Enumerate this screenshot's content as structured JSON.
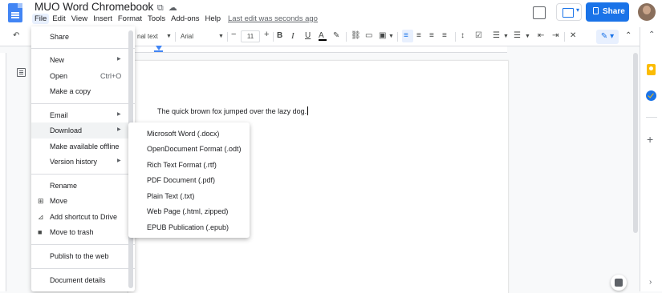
{
  "app": {
    "title": "MUO Word Chromebook",
    "last_edit": "Last edit was seconds ago",
    "share_label": "Share"
  },
  "menubar": [
    "File",
    "Edit",
    "View",
    "Insert",
    "Format",
    "Tools",
    "Add-ons",
    "Help"
  ],
  "toolbar": {
    "style": "nal text",
    "font": "Arial",
    "font_size": "11",
    "minus": "−",
    "plus": "+",
    "bold": "B",
    "italic": "I",
    "underline": "U",
    "text_color": "A"
  },
  "document": {
    "text": "The quick brown fox jumped over the lazy dog."
  },
  "file_menu": {
    "items": [
      {
        "label": "Share",
        "icon": "",
        "shortcut": "",
        "submenu": false
      },
      {
        "label": "New",
        "icon": "",
        "shortcut": "",
        "submenu": true
      },
      {
        "label": "Open",
        "icon": "",
        "shortcut": "Ctrl+O",
        "submenu": false
      },
      {
        "label": "Make a copy",
        "icon": "",
        "shortcut": "",
        "submenu": false
      },
      {
        "label": "Email",
        "icon": "",
        "shortcut": "",
        "submenu": true
      },
      {
        "label": "Download",
        "icon": "",
        "shortcut": "",
        "submenu": true
      },
      {
        "label": "Make available offline",
        "icon": "",
        "shortcut": "",
        "submenu": false
      },
      {
        "label": "Version history",
        "icon": "",
        "shortcut": "",
        "submenu": true
      },
      {
        "label": "Rename",
        "icon": "",
        "shortcut": "",
        "submenu": false
      },
      {
        "label": "Move",
        "icon": "folder-move-icon",
        "shortcut": "",
        "submenu": false
      },
      {
        "label": "Add shortcut to Drive",
        "icon": "drive-shortcut-icon",
        "shortcut": "",
        "submenu": false
      },
      {
        "label": "Move to trash",
        "icon": "trash-icon",
        "shortcut": "",
        "submenu": false
      },
      {
        "label": "Publish to the web",
        "icon": "",
        "shortcut": "",
        "submenu": false
      },
      {
        "label": "Document details",
        "icon": "",
        "shortcut": "",
        "submenu": false
      }
    ],
    "hovered": "Download"
  },
  "download_submenu": {
    "items": [
      "Microsoft Word (.docx)",
      "OpenDocument Format (.odt)",
      "Rich Text Format (.rtf)",
      "PDF Document (.pdf)",
      "Plain Text (.txt)",
      "Web Page (.html, zipped)",
      "EPUB Publication (.epub)"
    ]
  },
  "colors": {
    "accent": "#1a73e8",
    "docs_blue": "#4285f4",
    "keep_yellow": "#fbbc04"
  }
}
